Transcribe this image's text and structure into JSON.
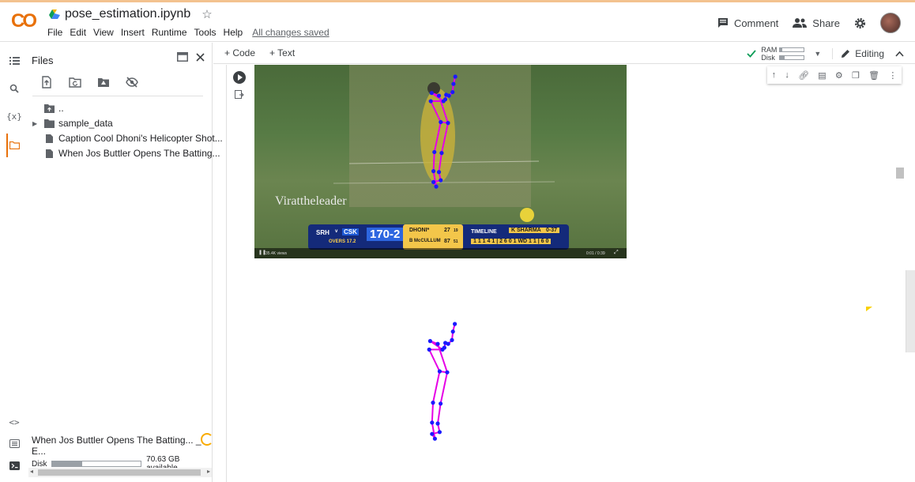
{
  "header": {
    "logo": "CO",
    "notebook_title": "pose_estimation.ipynb",
    "menu": [
      "File",
      "Edit",
      "View",
      "Insert",
      "Runtime",
      "Tools",
      "Help"
    ],
    "save_status": "All changes saved",
    "comment_label": "Comment",
    "share_label": "Share"
  },
  "files_panel": {
    "title": "Files",
    "tree": [
      {
        "name": "..",
        "type": "folder-up"
      },
      {
        "name": "sample_data",
        "type": "folder"
      },
      {
        "name": "Caption Cool Dhoni's Helicopter Shot...",
        "type": "file"
      },
      {
        "name": "When Jos Buttler Opens The Batting...",
        "type": "file"
      }
    ],
    "upload_file": "When Jos Buttler Opens The Batting... _ E...",
    "disk_label": "Disk",
    "disk_available": "70.63 GB available",
    "disk_usage": 0.34
  },
  "toolbar": {
    "add_code": "+ Code",
    "add_text": "+ Text",
    "ram_label": "RAM",
    "disk_label": "Disk",
    "ram_usage": 0.08,
    "disk_usage": 0.2,
    "editing_label": "Editing"
  },
  "video": {
    "watermark": "Virattheleader",
    "score_team1": "SRH",
    "score_vs": "v",
    "score_team2": "CSK",
    "score_total": "170-2",
    "overs": "OVERS 17.2",
    "batter1": "DHONI*",
    "batter1_runs": "27",
    "batter1_balls": "19",
    "batter2": "B McCULLUM",
    "batter2_runs": "87",
    "batter2_balls": "51",
    "timeline_label": "TIMELINE",
    "bowler": "K SHARMA",
    "bowler_figures": "0-37",
    "timeline_balls": "1 1 1 4 1 | 2 6 0 1 WD 1 1 | 6 0",
    "views": "35.4K views",
    "time": "0:01 / 0:39"
  },
  "colors": {
    "skeleton_line": "#e600e6",
    "keypoint": "#1a1aff",
    "accent": "#e8710a",
    "logo": "#f9ab00"
  }
}
